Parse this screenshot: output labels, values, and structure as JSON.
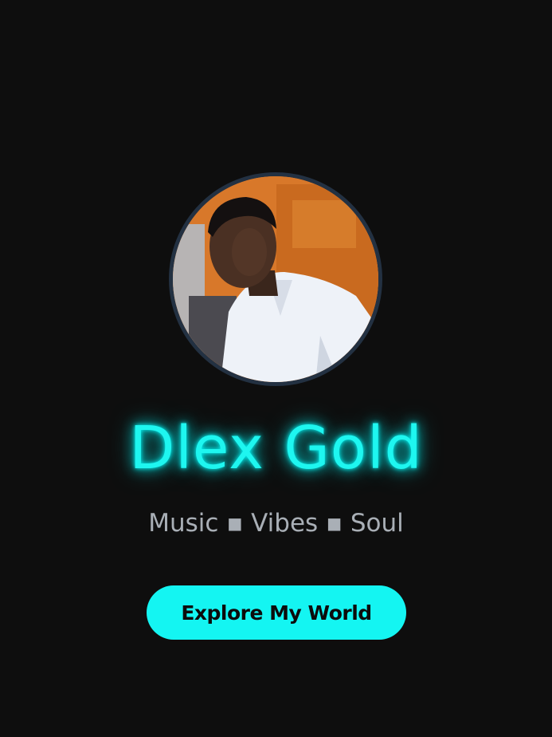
{
  "profile": {
    "name": "Dlex Gold",
    "tagline": "Music ▪ Vibes ▪ Soul",
    "avatar_alt": "profile photo"
  },
  "cta": {
    "label": "Explore My World"
  },
  "colors": {
    "background": "#0e0e0e",
    "accent": "#1ef6f0",
    "avatar_border": "#233142",
    "tagline": "#a9afb6"
  }
}
